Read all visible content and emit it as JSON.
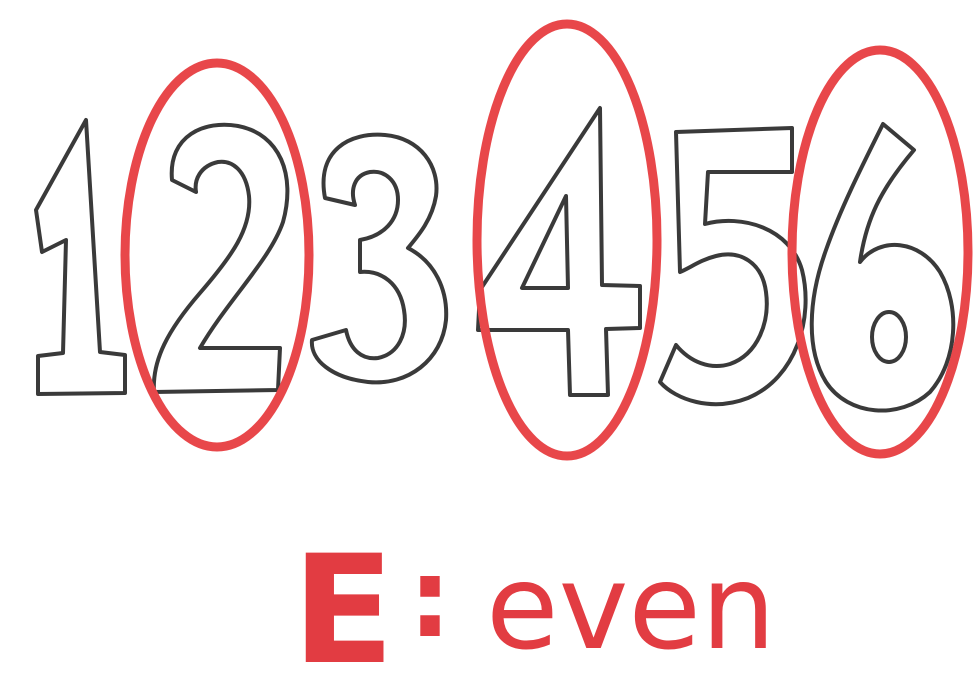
{
  "digits": [
    "1",
    "2",
    "3",
    "4",
    "5",
    "6"
  ],
  "circled_digits": [
    "2",
    "4",
    "6"
  ],
  "caption": {
    "letter": "E",
    "separator": ":",
    "word": "even"
  },
  "colors": {
    "background": "#ffffff",
    "outline": "#3a3a3a",
    "highlight": "#e8474a",
    "caption_red": "#e23c42"
  }
}
